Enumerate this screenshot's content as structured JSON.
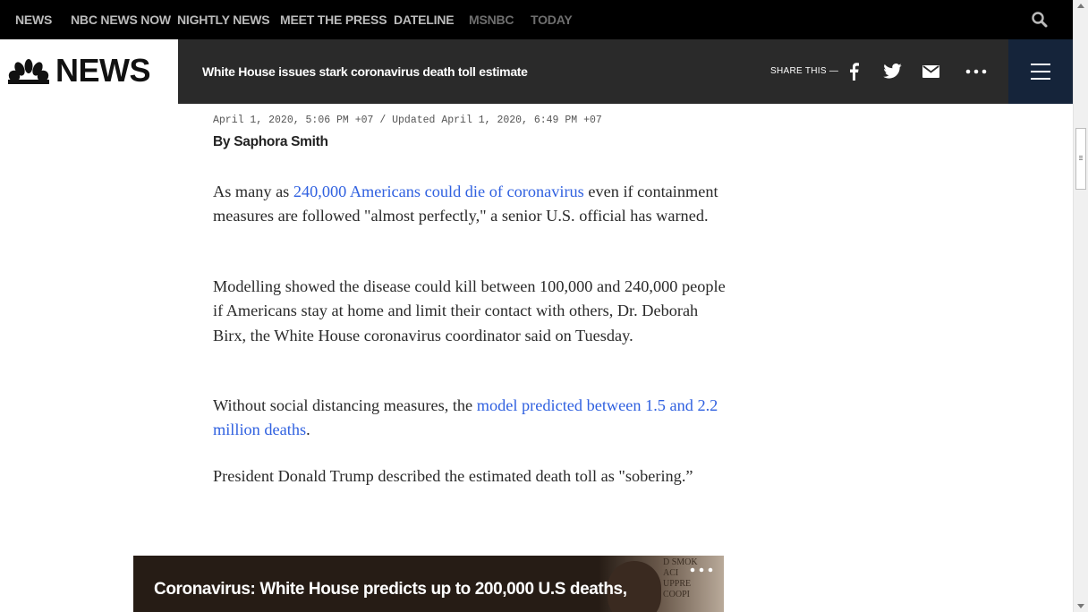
{
  "topnav": {
    "items": [
      "NEWS",
      "NBC NEWS NOW",
      "NIGHTLY NEWS",
      "MEET THE PRESS",
      "DATELINE",
      "MSNBC",
      "TODAY"
    ]
  },
  "header": {
    "logo_text": "NEWS",
    "headline": "White House issues stark coronavirus death toll estimate",
    "share_label": "SHARE THIS —",
    "share_icons": [
      "facebook-icon",
      "twitter-icon",
      "email-icon",
      "more-icon"
    ]
  },
  "article": {
    "dateline": "April 1, 2020, 5:06 PM +07 / Updated April 1, 2020, 6:49 PM +07",
    "byline": "By Saphora Smith",
    "p1_before": "As many as ",
    "p1_link": "240,000 Americans could die of coronavirus",
    "p1_after": " even if containment measures are followed \"almost perfectly,\" a senior U.S. official has warned.",
    "p2": "Modelling showed the disease could kill between 100,000 and 240,000 people if Americans stay at home and limit their contact with others, Dr. Deborah Birx, the White House coronavirus coordinator said on Tuesday.",
    "p3_before": "Without social distancing measures, the ",
    "p3_link": "model predicted between 1.5 and 2.2 million deaths",
    "p3_after": ".",
    "p4": "President Donald Trump described the estimated death toll as \"sobering.”"
  },
  "video": {
    "title": "Coronavirus: White House predicts up to 200,000 U.S deaths,",
    "sign_text": "D SMOK\nACI\nUPPRE\nCOOPI"
  },
  "colors": {
    "link": "#3061e0",
    "topnav_bg": "#000000",
    "header_bg": "#2a2a2a",
    "menu_bg": "#15243a"
  }
}
